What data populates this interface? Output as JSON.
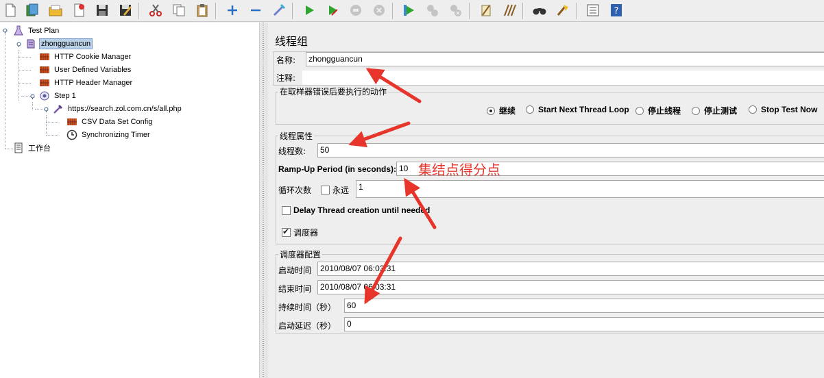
{
  "toolbar": {
    "buttons": [
      {
        "icon": "new-file-icon"
      },
      {
        "icon": "templates-icon"
      },
      {
        "icon": "open-icon"
      },
      {
        "icon": "close-file-icon"
      },
      {
        "icon": "save-icon"
      },
      {
        "icon": "save-as-icon"
      },
      {
        "icon": "cut-icon"
      },
      {
        "icon": "copy-icon"
      },
      {
        "icon": "paste-icon"
      },
      {
        "icon": "expand-icon"
      },
      {
        "icon": "collapse-icon"
      },
      {
        "icon": "toggle-icon"
      },
      {
        "icon": "start-icon"
      },
      {
        "icon": "start-no-pauses-icon"
      },
      {
        "icon": "stop-icon"
      },
      {
        "icon": "shutdown-icon"
      },
      {
        "icon": "remote-start-icon"
      },
      {
        "icon": "remote-stop-icon"
      },
      {
        "icon": "remote-shutdown-icon"
      },
      {
        "icon": "clear-icon"
      },
      {
        "icon": "clear-all-icon"
      },
      {
        "icon": "search-icon"
      },
      {
        "icon": "reset-search-icon"
      },
      {
        "icon": "function-helper-icon"
      },
      {
        "icon": "help-icon"
      }
    ]
  },
  "tree": {
    "test_plan": "Test Plan",
    "thread_group": "zhongguancun",
    "cookie_manager": "HTTP Cookie Manager",
    "user_vars": "User Defined Variables",
    "header_manager": "HTTP Header Manager",
    "step": "Step 1",
    "sampler": "https://search.zol.com.cn/s/all.php",
    "csv": "CSV Data Set Config",
    "timer": "Synchronizing Timer",
    "workbench": "工作台"
  },
  "panel": {
    "title": "线程组",
    "name_label": "名称:",
    "name_value": "zhongguancun",
    "comment_label": "注释:",
    "comment_value": "",
    "error_action": {
      "title": "在取样器错误后要执行的动作",
      "options": [
        "继续",
        "Start Next Thread Loop",
        "停止线程",
        "停止测试",
        "Stop Test Now"
      ],
      "selected": "继续"
    },
    "thread_props": {
      "title": "线程属性",
      "threads_label": "线程数:",
      "threads_value": "50",
      "rampup_label": "Ramp-Up Period (in seconds):",
      "rampup_value": "10",
      "loop_label": "循环次数",
      "forever_label": "永远",
      "loop_value": "1",
      "delay_label": "Delay Thread creation until needed",
      "scheduler_label": "调度器"
    },
    "scheduler": {
      "title": "调度器配置",
      "start_label": "启动时间",
      "start_value": "2010/08/07 06:03:31",
      "end_label": "结束时间",
      "end_value": "2010/08/07 06:03:31",
      "duration_label": "持续时间（秒）",
      "duration_value": "60",
      "delay_label": "启动延迟（秒）",
      "delay_value": "0"
    }
  },
  "annotation": {
    "text": "集结点得分点",
    "color": "#e8352b"
  }
}
